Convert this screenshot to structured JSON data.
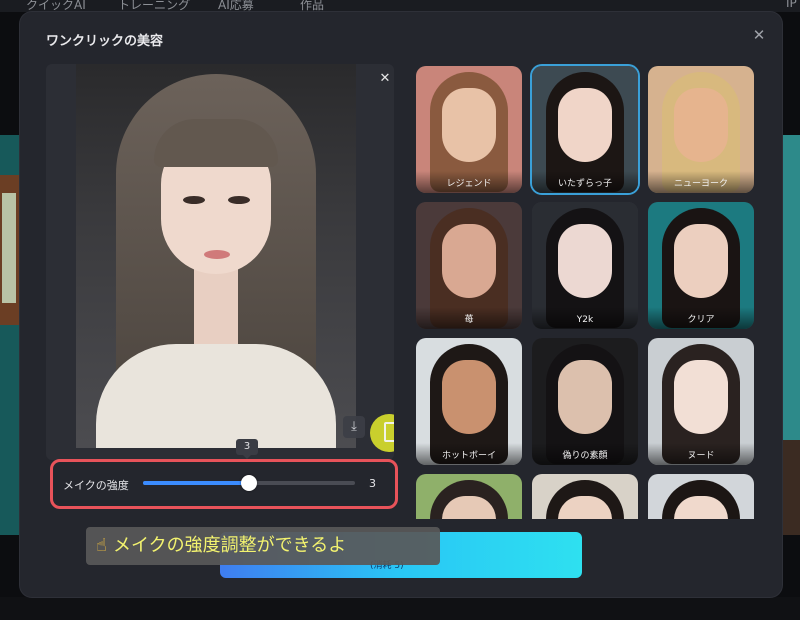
{
  "background": {
    "nav_items": [
      "クイックAI",
      "トレーニング",
      "AI応募",
      "作品",
      "IP"
    ]
  },
  "modal": {
    "title": "ワンクリックの美容",
    "close_icon": "close-icon"
  },
  "preview": {
    "close_icon": "close-icon",
    "download_icon": "download-icon",
    "compare_icon": "compare-icon"
  },
  "intensity": {
    "label": "メイクの強度",
    "value": "3",
    "tooltip": "3",
    "level_fraction": 0.5
  },
  "generate_button": {
    "sub_label": "(消耗 5)"
  },
  "caption": {
    "icon": "pointing-hand-icon",
    "text": "メイクの強度調整ができるよ"
  },
  "styles": [
    {
      "label": "レジェンド",
      "selected": false,
      "bg": "#c9857a",
      "hair": "#8a5a3f",
      "skin": "#e8c2a7"
    },
    {
      "label": "いたずらっ子",
      "selected": true,
      "bg": "#3d4a52",
      "hair": "#1c1614",
      "skin": "#f0d5c8"
    },
    {
      "label": "ニューヨーク",
      "selected": false,
      "bg": "#d6b28f",
      "hair": "#d8b97e",
      "skin": "#e6b48e"
    },
    {
      "label": "苺",
      "selected": false,
      "bg": "#4b3a3a",
      "hair": "#4a2e22",
      "skin": "#d9a892"
    },
    {
      "label": "Y2k",
      "selected": false,
      "bg": "#2a2d33",
      "hair": "#141214",
      "skin": "#ecd8d2"
    },
    {
      "label": "クリア",
      "selected": false,
      "bg": "#1c7a80",
      "hair": "#1a1413",
      "skin": "#eccfbf"
    },
    {
      "label": "ホットボーイ",
      "selected": false,
      "bg": "#d8dde0",
      "hair": "#1e1816",
      "skin": "#c9916f"
    },
    {
      "label": "偽りの素顔",
      "selected": false,
      "bg": "#1c1c1e",
      "hair": "#141214",
      "skin": "#dcc0ad"
    },
    {
      "label": "ヌード",
      "selected": false,
      "bg": "#c9ced2",
      "hair": "#2a2220",
      "skin": "#f2dfd5"
    },
    {
      "label": "",
      "selected": false,
      "bg": "#8fb06a",
      "hair": "#2a2220",
      "skin": "#e6c9b6"
    },
    {
      "label": "",
      "selected": false,
      "bg": "#d8d2c8",
      "hair": "#1e1816",
      "skin": "#ecd2c2"
    },
    {
      "label": "",
      "selected": false,
      "bg": "#d2d6da",
      "hair": "#1c1614",
      "skin": "#f0d9cc"
    }
  ],
  "colors": {
    "modal_bg": "#24262d",
    "accent": "#3b8cff",
    "highlight_border": "#e8535a",
    "selected_border": "#3aa0d8"
  }
}
